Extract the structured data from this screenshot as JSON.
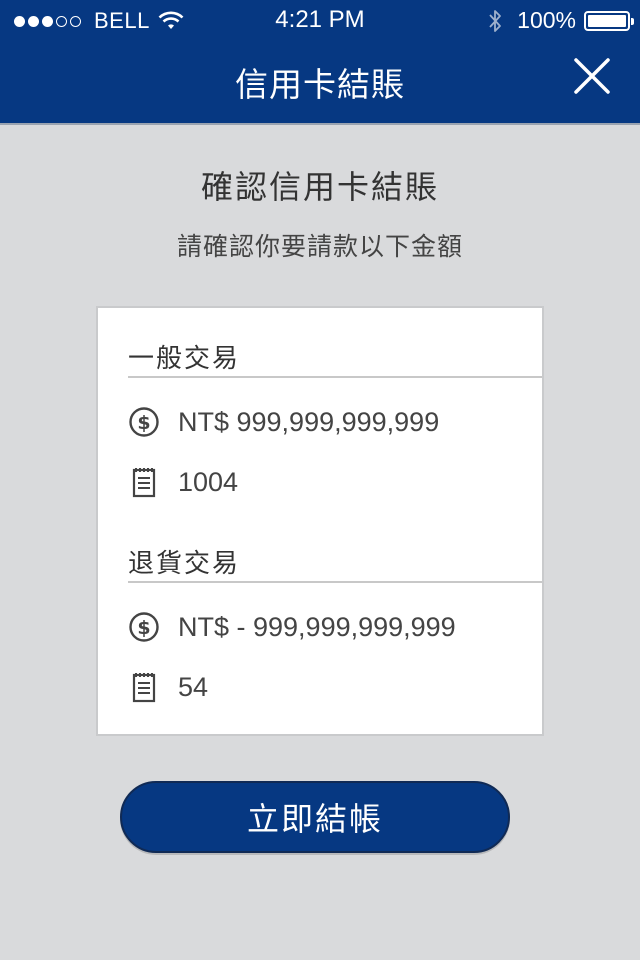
{
  "status_bar": {
    "carrier": "BELL",
    "time": "4:21 PM",
    "battery": "100%"
  },
  "nav": {
    "title": "信用卡結賬"
  },
  "confirm": {
    "title": "確認信用卡結賬",
    "subtitle": "請確認你要請款以下金額"
  },
  "sections": [
    {
      "title": "一般交易",
      "amount": "NT$ 999,999,999,999",
      "count": "1004"
    },
    {
      "title": "退貨交易",
      "amount": "NT$ - 999,999,999,999",
      "count": "54"
    }
  ],
  "actions": {
    "checkout_label": "立即結帳"
  },
  "colors": {
    "brand": "#063882",
    "background": "#d9dadc",
    "card": "#ffffff"
  },
  "icons": {
    "close": "close-icon",
    "amount": "dollar-circle-icon",
    "count": "receipt-list-icon"
  }
}
